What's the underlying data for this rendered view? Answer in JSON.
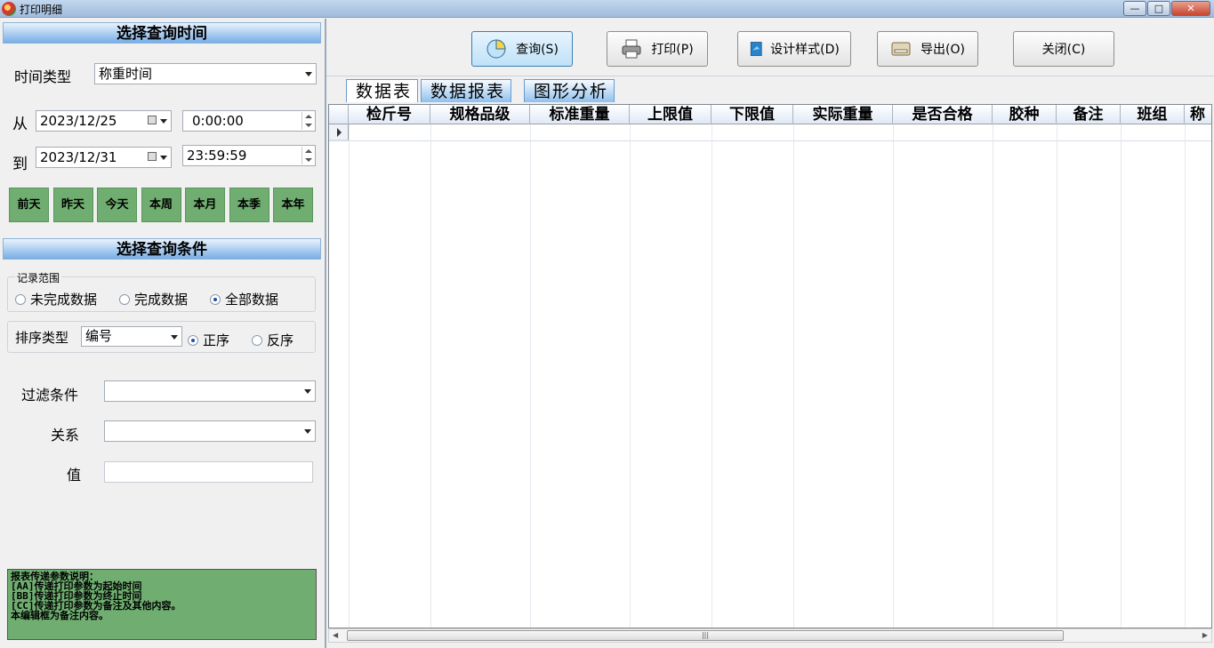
{
  "window": {
    "title": "打印明细",
    "minimize": "—",
    "maximize": "□",
    "close": "✕"
  },
  "time_section": {
    "header": "选择查询时间",
    "time_type_label": "时间类型",
    "time_type_value": "称重时间",
    "from_label": "从",
    "from_date": "2023/12/25",
    "from_time": "0:00:00",
    "to_label": "到",
    "to_date": "2023/12/31",
    "to_time": "23:59:59",
    "quick": [
      "前天",
      "昨天",
      "今天",
      "本周",
      "本月",
      "本季",
      "本年"
    ]
  },
  "condition_section": {
    "header": "选择查询条件",
    "range_title": "记录范围",
    "range_options": [
      "未完成数据",
      "完成数据",
      "全部数据"
    ],
    "sort_label": "排序类型",
    "sort_value": "编号",
    "sort_asc": "正序",
    "sort_desc": "反序",
    "filter_label": "过滤条件",
    "relation_label": "关系",
    "value_label": "值",
    "filter_value": "",
    "relation_value": "",
    "value_value": ""
  },
  "notes": {
    "line1": "报表传递参数说明：",
    "line2": "[AA]传递打印参数为起始时间",
    "line3": "[BB]传递打印参数为终止时间",
    "line4": "[CC]传递打印参数为备注及其他内容。",
    "line5": "本编辑框为备注内容。"
  },
  "toolbar": {
    "query": "查询(S)",
    "print": "打印(P)",
    "design": "设计样式(D)",
    "export": "导出(O)",
    "close": "关闭(C)"
  },
  "tabs": [
    "数据表",
    "数据报表",
    "图形分析"
  ],
  "grid": {
    "columns": [
      "检斤号",
      "规格品级",
      "标准重量",
      "上限值",
      "下限值",
      "实际重量",
      "是否合格",
      "胶种",
      "备注",
      "班组",
      "称"
    ]
  },
  "colors": {
    "accent_green": "#6fae70",
    "header_blue": "#77aee6"
  }
}
